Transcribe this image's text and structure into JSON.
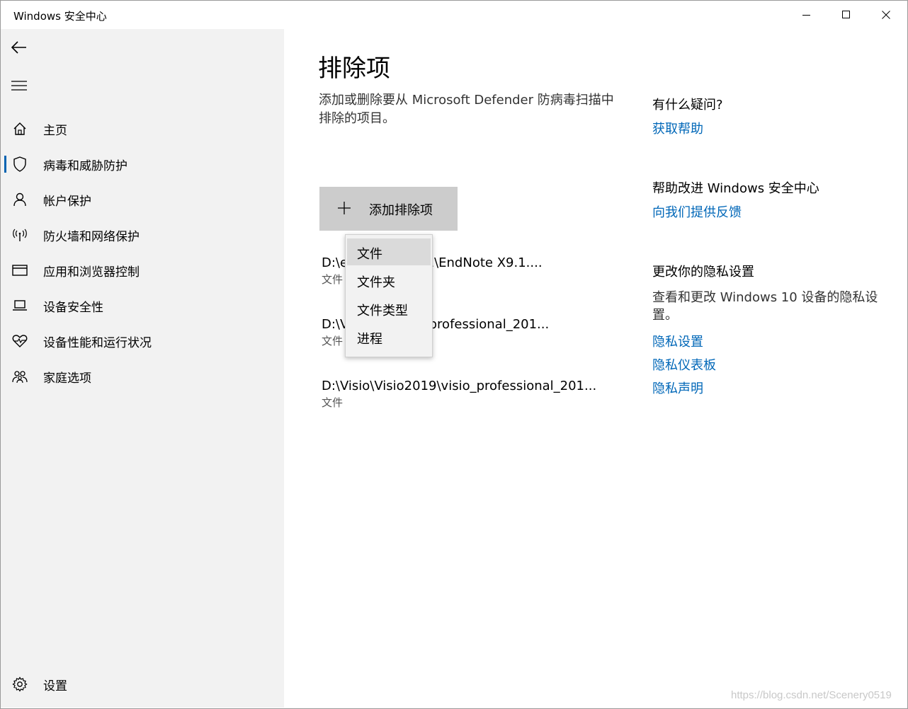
{
  "window": {
    "title": "Windows 安全中心"
  },
  "sidebar": {
    "items": [
      {
        "label": "主页"
      },
      {
        "label": "病毒和威胁防护"
      },
      {
        "label": "帐户保护"
      },
      {
        "label": "防火墙和网络保护"
      },
      {
        "label": "应用和浏览器控制"
      },
      {
        "label": "设备安全性"
      },
      {
        "label": "设备性能和运行状况"
      },
      {
        "label": "家庭选项"
      }
    ],
    "settings_label": "设置",
    "active_index": 1,
    "accent": "#0063b1"
  },
  "main": {
    "title": "排除项",
    "description": "添加或删除要从 Microsoft Defender 防病毒扫描中排除的项目。",
    "add_button_label": "添加排除项",
    "exclusions": [
      {
        "path": "D:\\e          te X9.1\\EndNote X9.1....",
        "type": "文件"
      },
      {
        "path": "D:\\V          \\visio_professional_201...",
        "type": "文件"
      },
      {
        "path": "D:\\Visio\\Visio2019\\visio_professional_201...",
        "type": "文件"
      }
    ]
  },
  "dropdown": {
    "items": [
      "文件",
      "文件夹",
      "文件类型",
      "进程"
    ],
    "highlighted_index": 0
  },
  "help": {
    "question_heading": "有什么疑问?",
    "get_help_link": "获取帮助",
    "improve_heading": "帮助改进 Windows 安全中心",
    "feedback_link": "向我们提供反馈",
    "privacy_heading": "更改你的隐私设置",
    "privacy_text": "查看和更改 Windows 10 设备的隐私设置。",
    "privacy_links": [
      "隐私设置",
      "隐私仪表板",
      "隐私声明"
    ],
    "link_color": "#0067b8"
  },
  "watermark": "https://blog.csdn.net/Scenery0519"
}
